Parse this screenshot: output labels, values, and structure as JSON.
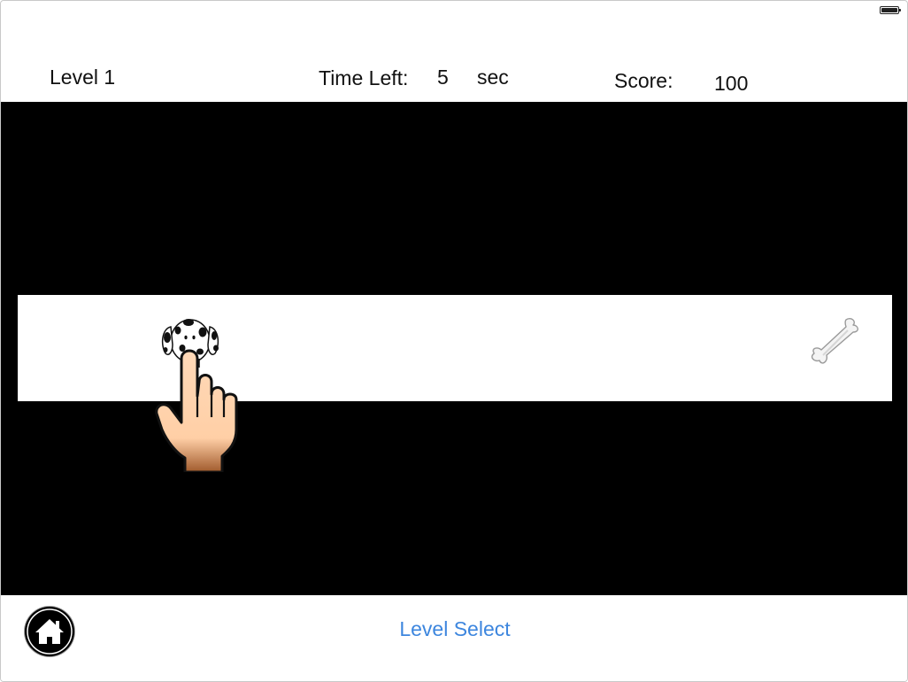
{
  "hud": {
    "level": "Level 1",
    "time_label": "Time Left:",
    "time_value": "5",
    "time_unit": "sec",
    "score_label": "Score:",
    "score_value": "100"
  },
  "game": {
    "sprites": [
      "dalmatian-dog-icon",
      "bone-icon",
      "pointing-hand-icon"
    ]
  },
  "bottom": {
    "level_select": "Level Select",
    "home_icon": "home-icon"
  },
  "colors": {
    "play_area": "#000000",
    "lane": "#ffffff",
    "link": "#3d86de"
  }
}
